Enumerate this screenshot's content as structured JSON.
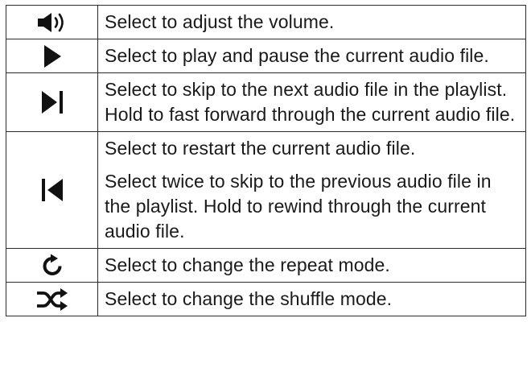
{
  "rows": [
    {
      "icon": "volume-icon",
      "paragraphs": [
        "Select to adjust the volume."
      ]
    },
    {
      "icon": "play-icon",
      "paragraphs": [
        "Select to play and pause the current audio file."
      ]
    },
    {
      "icon": "skip-next-icon",
      "paragraphs": [
        "Select to skip to the next audio file in the playlist. Hold to fast forward through the current audio file."
      ]
    },
    {
      "icon": "skip-previous-icon",
      "paragraphs": [
        "Select to restart the current audio file.",
        "Select twice to skip to the previous audio file in the playlist. Hold to rewind through the current audio file."
      ]
    },
    {
      "icon": "repeat-icon",
      "paragraphs": [
        "Select to change the repeat mode."
      ]
    },
    {
      "icon": "shuffle-icon",
      "paragraphs": [
        "Select to change the shuffle mode."
      ]
    }
  ]
}
